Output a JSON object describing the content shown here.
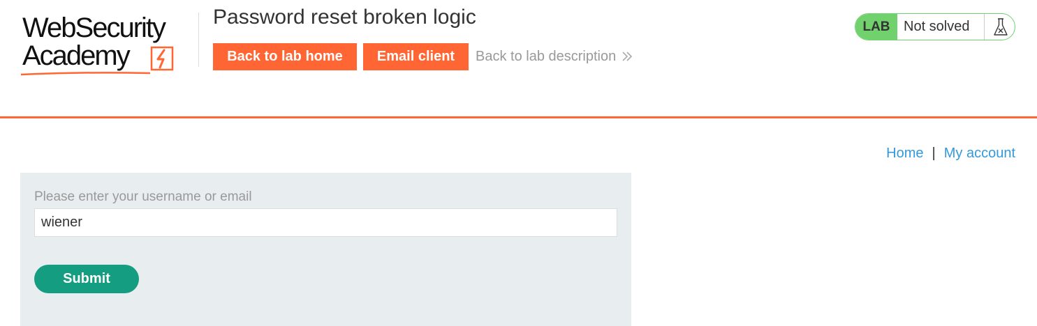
{
  "header": {
    "logo": {
      "line1": "WebSecurity",
      "line2": "Academy"
    },
    "lab_title": "Password reset broken logic",
    "buttons": {
      "back_to_lab_home": "Back to lab home",
      "email_client": "Email client"
    },
    "back_to_description": "Back to lab description",
    "lab_status": {
      "tag": "LAB",
      "status": "Not solved",
      "icon": "flask-icon"
    },
    "accent_color": "#ff6633"
  },
  "nav": {
    "home": "Home",
    "separator": "|",
    "my_account": "My account"
  },
  "form": {
    "label": "Please enter your username or email",
    "username_value": "wiener",
    "submit_label": "Submit",
    "submit_color": "#159d81"
  }
}
